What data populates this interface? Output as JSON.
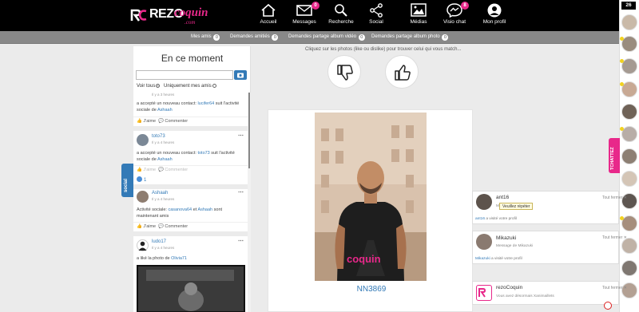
{
  "brand": {
    "rezo": "REZO",
    "coquin": "coquin",
    "com": ".com",
    "accent": "#e8288a"
  },
  "nav": [
    {
      "label": "Accueil",
      "icon": "home-icon",
      "badge": ""
    },
    {
      "label": "Messages",
      "icon": "envelope-icon",
      "badge": "0"
    },
    {
      "label": "Recherche",
      "icon": "search-icon",
      "badge": ""
    },
    {
      "label": "Social",
      "icon": "share-icon",
      "badge": ""
    },
    {
      "label": "Médias",
      "icon": "image-icon",
      "badge": ""
    },
    {
      "label": "Visio chat",
      "icon": "messenger-icon",
      "badge": "8"
    },
    {
      "label": "Mon profil",
      "icon": "user-icon",
      "badge": ""
    }
  ],
  "online_count": "26",
  "subnav": [
    {
      "label": "Mes amis",
      "count": "0"
    },
    {
      "label": "Demandes amitiés",
      "count": "0"
    },
    {
      "label": "Demandes partage album vidéo",
      "count": "0"
    },
    {
      "label": "Demandes partage album photo",
      "count": "0"
    }
  ],
  "panel": {
    "title": "En ce moment",
    "search_value": "",
    "filter_all": "Voir tous",
    "filter_friends": "Uniquement mes amis"
  },
  "posts": [
    {
      "time": "Il y a 3 heures",
      "text_a": "a accepté un nouveau contact: ",
      "link1": "lucifer64",
      "text_b": " suit l'activité sociale de ",
      "link2": "Ashaah",
      "like": "J'aime",
      "comment": "Commenter"
    },
    {
      "user": "toto73",
      "time": "Il y a 4 heures",
      "text_a": "a accepté un nouveau contact: ",
      "link1": "toto73",
      "text_b": " suit l'activité sociale de ",
      "link2": "Ashaah",
      "like": "J'aime",
      "comment": "Commenter",
      "likes_count": "1"
    },
    {
      "user": "Ashaah",
      "time": "Il y a 4 heures",
      "text_a": "Activité sociale: ",
      "link1": "casanova64",
      "text_b": " et ",
      "link2": "Ashaah",
      "text_c": " sont maintenant amis",
      "like": "J'aime",
      "comment": "Commenter"
    },
    {
      "user": "ludo17",
      "time": "Il y a 4 heures",
      "text_a": "a liké la photo de ",
      "link1": "Olivia71"
    }
  ],
  "social_tab": "social",
  "tchat_tab": "TCHATTEZ",
  "match": {
    "instruction": "Cliquez sur les photos (like ou dislike) pour trouver celui qui vous match...",
    "name": "NN3869"
  },
  "notifications": [
    {
      "name": "ant16",
      "close": "Tout fermer",
      "message": "Message de ant16",
      "tooltip": "Veuillez répéter",
      "footer_link": "ant16",
      "footer_text": " a visité votre profil"
    },
    {
      "name": "Mikazuki",
      "close": "Tout fermer",
      "message": "Message de Mikazuki",
      "footer_link": "Mikazuki",
      "footer_text": " a visité votre profil"
    },
    {
      "name": "rezoCoquin",
      "close": "Tout fermer",
      "message": "Vous avez désormais Xanimaillets"
    }
  ]
}
